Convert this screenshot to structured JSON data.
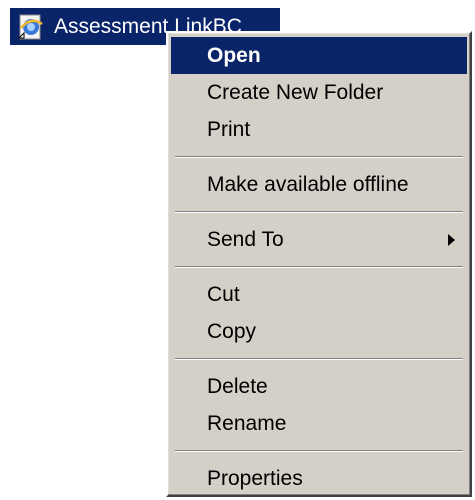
{
  "desktop_item": {
    "label": "Assessment LinkBC",
    "icon": "internet-shortcut-icon"
  },
  "context_menu": {
    "items": [
      {
        "label": "Open",
        "selected": true
      },
      {
        "label": "Create New Folder"
      },
      {
        "label": "Print"
      },
      {
        "label": "Make available offline"
      },
      {
        "label": "Send To",
        "submenu": true
      },
      {
        "label": "Cut"
      },
      {
        "label": "Copy"
      },
      {
        "label": "Delete"
      },
      {
        "label": "Rename"
      },
      {
        "label": "Properties"
      }
    ]
  },
  "colors": {
    "selection": "#0a246a",
    "menu_background": "#d4d0c8",
    "text": "#000000",
    "selected_text": "#ffffff"
  }
}
